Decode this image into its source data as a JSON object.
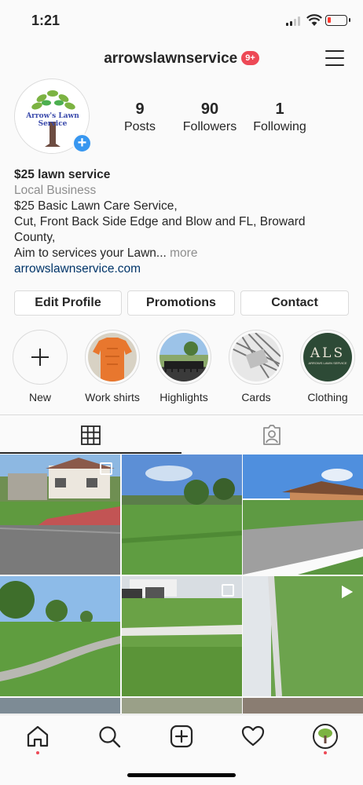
{
  "status_bar": {
    "time": "1:21"
  },
  "header": {
    "username": "arrowslawnservice",
    "notification_badge": "9+"
  },
  "profile": {
    "avatar_text": "Arrow's Lawn Service",
    "stats": [
      {
        "value": "9",
        "label": "Posts"
      },
      {
        "value": "90",
        "label": "Followers"
      },
      {
        "value": "1",
        "label": "Following"
      }
    ],
    "bio": {
      "name": "$25 lawn service",
      "category": "Local Business",
      "line1": "$25 Basic Lawn Care Service,",
      "line2": "Cut, Front Back Side Edge and Blow and FL, Broward County,",
      "line3": "Aim to services your Lawn...",
      "more": "more",
      "link": "arrowslawnservice.com"
    },
    "buttons": {
      "edit": "Edit Profile",
      "promotions": "Promotions",
      "contact": "Contact"
    }
  },
  "highlights": [
    {
      "label": "New"
    },
    {
      "label": "Work shirts"
    },
    {
      "label": "Highlights"
    },
    {
      "label": "Cards"
    },
    {
      "label": "Clothing",
      "cover_text": "ALS",
      "cover_subtext": "ARROWS LAWN SERVICE"
    }
  ],
  "tabs": [
    "grid-icon",
    "tagged-icon"
  ],
  "bottom_nav": [
    "home-icon",
    "search-icon",
    "new-post-icon",
    "activity-icon",
    "profile-icon"
  ],
  "colors": {
    "accent": "#3897f0",
    "badge": "#ed4956",
    "link": "#003569"
  }
}
